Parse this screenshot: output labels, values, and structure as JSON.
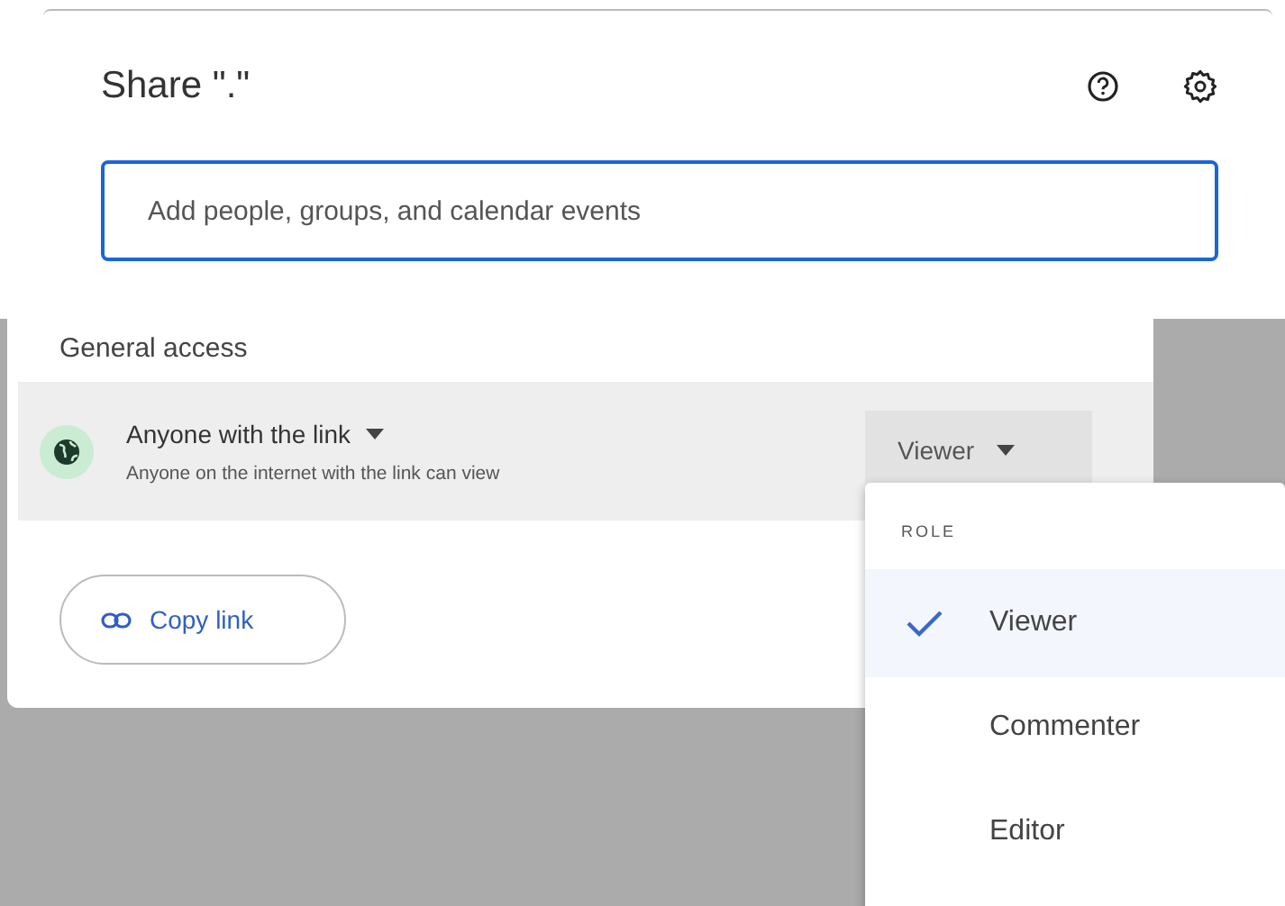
{
  "dialog": {
    "title": "Share \".\"",
    "search": {
      "placeholder": "Add people, groups, and calendar events"
    }
  },
  "general_access": {
    "heading": "General access",
    "scope": "Anyone with the link",
    "description": "Anyone on the internet with the link can view",
    "role": "Viewer"
  },
  "copy_link": {
    "label": "Copy link"
  },
  "role_menu": {
    "heading": "ROLE",
    "items": [
      {
        "label": "Viewer",
        "selected": true
      },
      {
        "label": "Commenter",
        "selected": false
      },
      {
        "label": "Editor",
        "selected": false
      }
    ]
  }
}
